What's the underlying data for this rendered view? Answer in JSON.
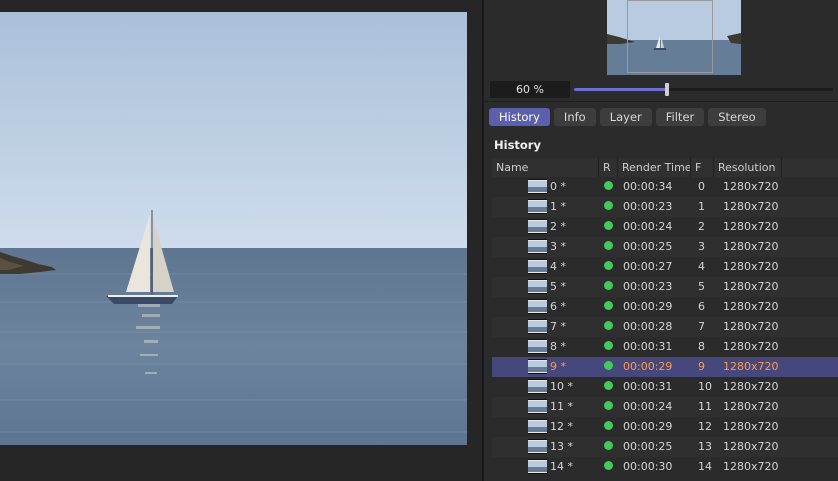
{
  "zoom": {
    "label": "60 %",
    "value_percent": 60
  },
  "tabs": [
    {
      "label": "History",
      "active": true
    },
    {
      "label": "Info",
      "active": false
    },
    {
      "label": "Layer",
      "active": false
    },
    {
      "label": "Filter",
      "active": false
    },
    {
      "label": "Stereo",
      "active": false
    }
  ],
  "history": {
    "title": "History",
    "columns": {
      "name": "Name",
      "r": "R",
      "render_time": "Render Time",
      "frame": "F",
      "resolution": "Resolution"
    },
    "rows": [
      {
        "name": "0 *",
        "time": "00:00:34",
        "frame": "0",
        "res": "1280x720"
      },
      {
        "name": "1 *",
        "time": "00:00:23",
        "frame": "1",
        "res": "1280x720"
      },
      {
        "name": "2 *",
        "time": "00:00:24",
        "frame": "2",
        "res": "1280x720"
      },
      {
        "name": "3 *",
        "time": "00:00:25",
        "frame": "3",
        "res": "1280x720"
      },
      {
        "name": "4 *",
        "time": "00:00:27",
        "frame": "4",
        "res": "1280x720"
      },
      {
        "name": "5 *",
        "time": "00:00:23",
        "frame": "5",
        "res": "1280x720"
      },
      {
        "name": "6 *",
        "time": "00:00:29",
        "frame": "6",
        "res": "1280x720"
      },
      {
        "name": "7 *",
        "time": "00:00:28",
        "frame": "7",
        "res": "1280x720"
      },
      {
        "name": "8 *",
        "time": "00:00:31",
        "frame": "8",
        "res": "1280x720"
      },
      {
        "name": "9 *",
        "time": "00:00:29",
        "frame": "9",
        "res": "1280x720",
        "selected": true
      },
      {
        "name": "10 *",
        "time": "00:00:31",
        "frame": "10",
        "res": "1280x720"
      },
      {
        "name": "11 *",
        "time": "00:00:24",
        "frame": "11",
        "res": "1280x720"
      },
      {
        "name": "12 *",
        "time": "00:00:29",
        "frame": "12",
        "res": "1280x720"
      },
      {
        "name": "13 *",
        "time": "00:00:25",
        "frame": "13",
        "res": "1280x720"
      },
      {
        "name": "14 *",
        "time": "00:00:30",
        "frame": "14",
        "res": "1280x720"
      }
    ]
  },
  "colors": {
    "accent": "#5a5fae",
    "selected_row": "#46477a",
    "selected_text": "#ff9a4a",
    "status_ok": "#3fcd58"
  }
}
